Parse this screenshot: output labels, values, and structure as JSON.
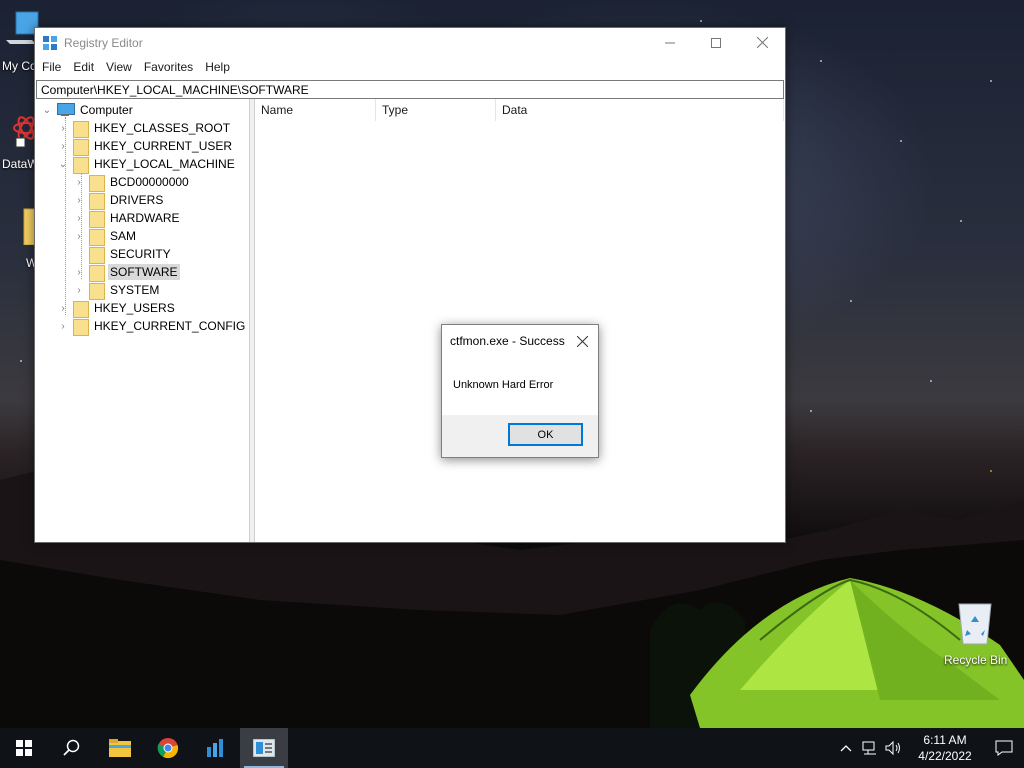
{
  "desktop": {
    "icons": [
      {
        "label": "My Co"
      },
      {
        "label": "DataW"
      },
      {
        "label": "W"
      },
      {
        "label": "Recycle Bin"
      }
    ]
  },
  "regedit": {
    "title": "Registry Editor",
    "menu": [
      "File",
      "Edit",
      "View",
      "Favorites",
      "Help"
    ],
    "address": "Computer\\HKEY_LOCAL_MACHINE\\SOFTWARE",
    "tree": {
      "root": "Computer",
      "hkcr": "HKEY_CLASSES_ROOT",
      "hkcu": "HKEY_CURRENT_USER",
      "hklm": "HKEY_LOCAL_MACHINE",
      "bcd": "BCD00000000",
      "drivers": "DRIVERS",
      "hardware": "HARDWARE",
      "sam": "SAM",
      "security": "SECURITY",
      "software": "SOFTWARE",
      "system": "SYSTEM",
      "hku": "HKEY_USERS",
      "hkcc": "HKEY_CURRENT_CONFIG"
    },
    "selected": "SOFTWARE",
    "columns": [
      "Name",
      "Type",
      "Data"
    ]
  },
  "dialog": {
    "title": "ctfmon.exe - Success",
    "message": "Unknown Hard Error",
    "ok_label": "OK"
  },
  "taskbar": {
    "apps": [
      "start-icon",
      "search-icon",
      "file-explorer-icon",
      "chrome-icon",
      "datawrapper-icon",
      "registry-editor-icon"
    ],
    "time": "6:11 AM",
    "date": "4/22/2022"
  },
  "colors": {
    "accent": "#0078d7",
    "taskbar": "#0f1318",
    "tent": "#8ccf2a",
    "selection": "#d9d9d9"
  }
}
